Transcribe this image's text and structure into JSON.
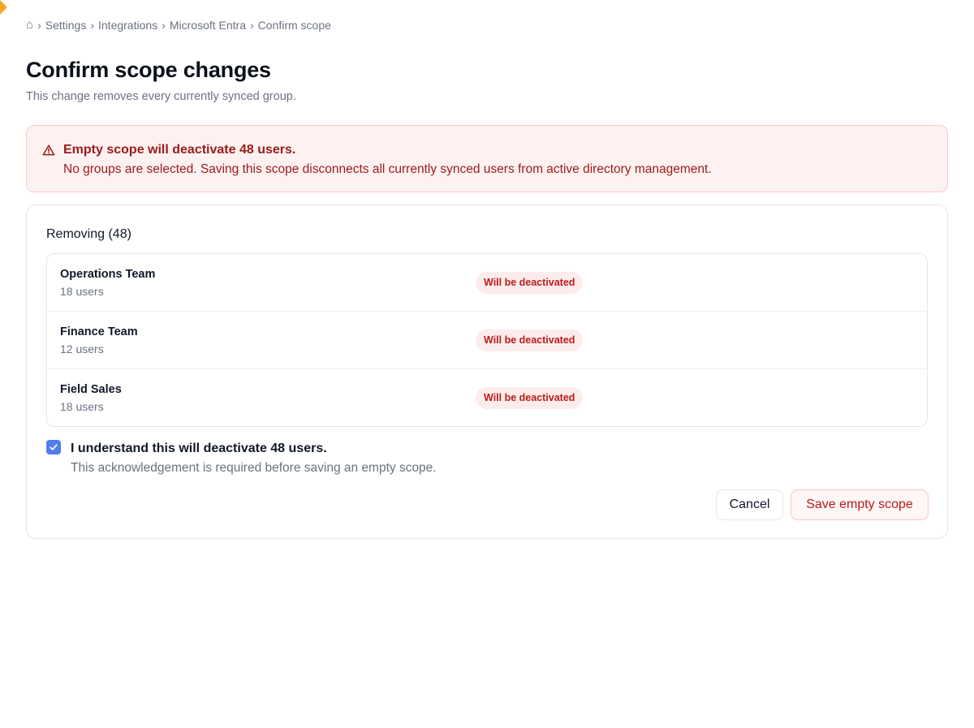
{
  "breadcrumb": {
    "home_icon": "⌂",
    "items": [
      "Settings",
      "Integrations",
      "Microsoft Entra"
    ],
    "current": "Confirm scope",
    "separator": "›"
  },
  "header": {
    "title": "Confirm scope changes",
    "subtitle": "This change removes every currently synced group."
  },
  "alert": {
    "icon": "warning-triangle-icon",
    "title": "Empty scope will deactivate 48 users.",
    "body": "No groups are selected. Saving this scope disconnects all currently synced users from active directory management."
  },
  "removing": {
    "label": "Removing (48)",
    "groups": [
      {
        "name": "Operations Team",
        "count": "18 users",
        "status": "Will be deactivated"
      },
      {
        "name": "Finance Team",
        "count": "12 users",
        "status": "Will be deactivated"
      },
      {
        "name": "Field Sales",
        "count": "18 users",
        "status": "Will be deactivated"
      }
    ]
  },
  "acknowledgement": {
    "checked": true,
    "label": "I understand this will deactivate 48 users.",
    "help": "This acknowledgement is required before saving an empty scope."
  },
  "actions": {
    "cancel_label": "Cancel",
    "save_label": "Save empty scope"
  },
  "colors": {
    "danger_text": "#991b1b",
    "danger_bg": "#fef1f1",
    "badge_text": "#b91c1c",
    "checkbox_accent": "#4f7df0"
  }
}
